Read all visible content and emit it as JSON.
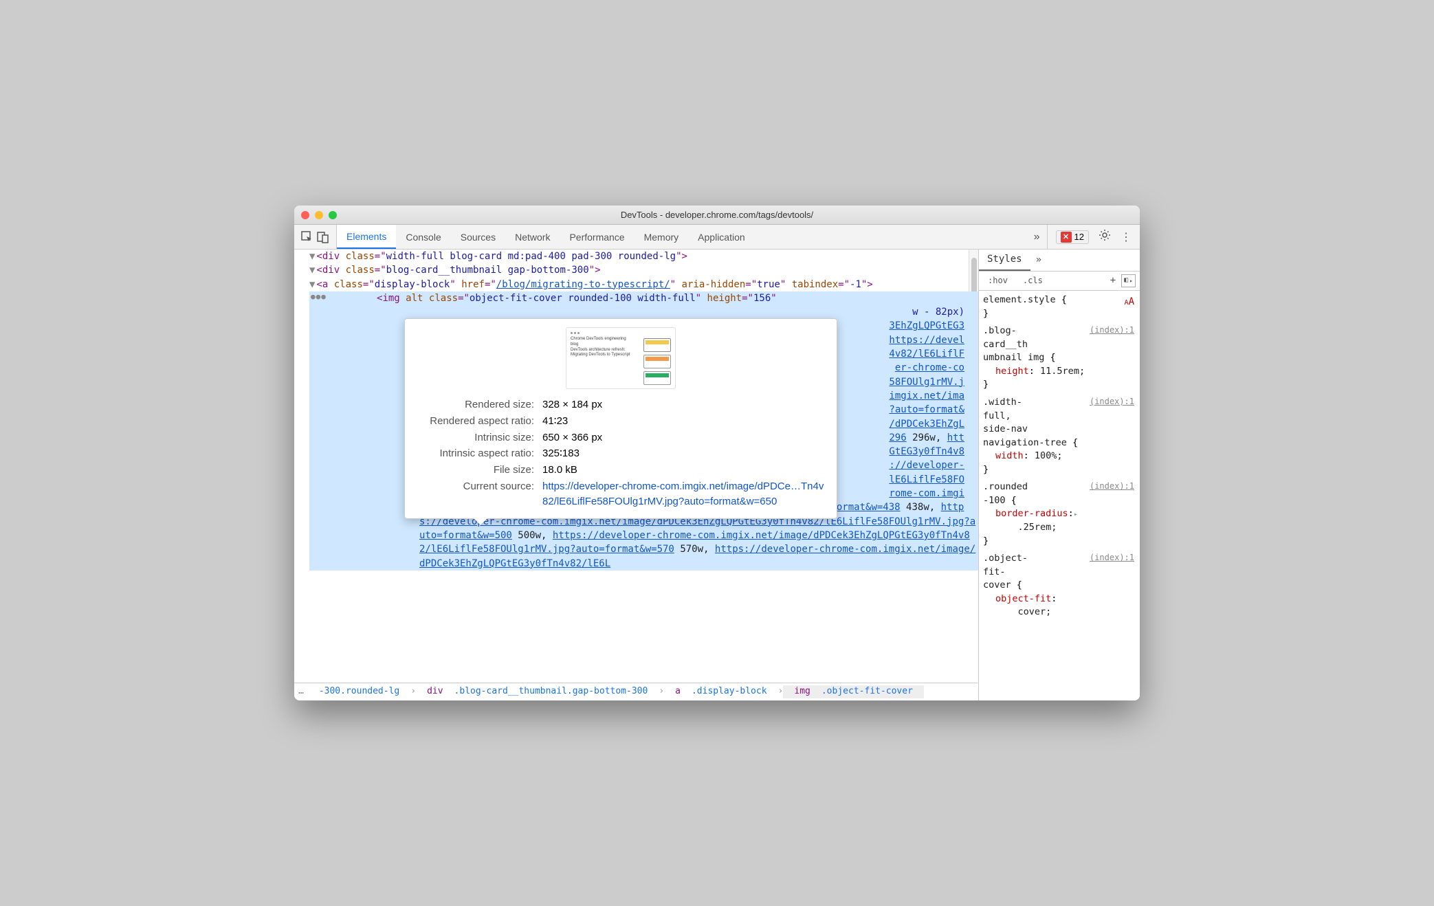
{
  "window": {
    "title": "DevTools - developer.chrome.com/tags/devtools/"
  },
  "tabs": [
    "Elements",
    "Console",
    "Sources",
    "Network",
    "Performance",
    "Memory",
    "Application"
  ],
  "activeTabIndex": 0,
  "errorCount": "12",
  "dom": {
    "l1_class": "width-full blog-card md:pad-400 pad-300 rounded-lg",
    "l2_class": "blog-card__thumbnail gap-bottom-300",
    "l3_class": "display-block",
    "l3_href": "/blog/migrating-to-typescript/",
    "l3_aria": "true",
    "l3_tabindex": "-1",
    "l4_tag": "img",
    "l4_class": "object-fit-cover rounded-100 width-full",
    "l4_height": "156",
    "snip_w82": "w - 82px)",
    "snip_hash": "3EhZgLQPGtEG3",
    "snip_https": "https://devel",
    "snip_4v82": "4v82/lE6LiflF",
    "snip_chrome": "er-chrome-co",
    "snip_58f": "58FOUlg1rMV.j",
    "snip_imgix": "imgix.net/ima",
    "snip_auto": "?auto=format&",
    "snip_dpd": "/dPDCek3EhZgL",
    "snip_296": "296",
    "snip_296w": "296w,",
    "snip_htt": "htt",
    "snip_gte": "GtEG3y0fTn4v8",
    "snip_dev2": "://developer-",
    "snip_le6": "lE6LiflFe58FO",
    "snip_rom": "rome-com.imgi",
    "srcset_l1": "x.net/image/dPDCek3EhZgLQPGtEG3y0fTn4v82/lE6LiflFe58FOUlg1rMV.jpg?auto=format&w=438",
    "srcset_l1w": "438w,",
    "srcset_l2": "https://developer-chrome-com.imgix.net/image/dPDCek3EhZgLQPGtEG3y0fTn4v82/lE6LiflFe58FOUlg1rMV.jpg?auto=format&w=500",
    "srcset_l2w": "500w,",
    "srcset_l3": "https://developer-chrome-com.imgix.net/image/dPDCek3EhZgLQPGtEG3y0fTn4v82/lE6LiflFe58FOUlg1rMV.jpg?auto=format&w=570",
    "srcset_l3w": "570w,",
    "srcset_l4": "https://developer-chrome-com.imgix.net/image/dPDCek3EhZgLQPGtEG3y0fTn4v82/lE6L"
  },
  "tooltip": {
    "thumb_line1": "Chrome DevTools engineering blog",
    "thumb_line2": "DevTools architecture refresh:",
    "thumb_line3": "Migrating DevTools to Typescript",
    "rows": [
      {
        "label": "Rendered size:",
        "value": "328 × 184 px"
      },
      {
        "label": "Rendered aspect ratio:",
        "value": "41∶23"
      },
      {
        "label": "Intrinsic size:",
        "value": "650 × 366 px"
      },
      {
        "label": "Intrinsic aspect ratio:",
        "value": "325∶183"
      },
      {
        "label": "File size:",
        "value": "18.0 kB"
      },
      {
        "label": "Current source:",
        "value": "https://developer-chrome-com.imgix.net/image/dPDCe…Tn4v82/lE6LiflFe58FOUlg1rMV.jpg?auto=format&w=650",
        "link": true
      }
    ]
  },
  "breadcrumb": [
    "…",
    "-300.rounded-lg",
    "div.blog-card__thumbnail.gap-bottom-300",
    "a.display-block",
    "img.object-fit-cover"
  ],
  "styles": {
    "tab": "Styles",
    "filterHov": ":hov",
    "filterCls": ".cls",
    "rules": [
      {
        "sel": "element.style {",
        "src": "",
        "props": []
      },
      {
        "sel": ".blog-card__thumbnail img {",
        "src": "(index):1",
        "props": [
          {
            "p": "height",
            "v": "11.5rem;"
          }
        ]
      },
      {
        "sel": ".width-full, side-nav navigation-tree {",
        "src": "(index):1",
        "props": [
          {
            "p": "width",
            "v": "100%;"
          }
        ]
      },
      {
        "sel": ".rounded-100 {",
        "src": "(index):1",
        "props": [
          {
            "p": "border-radius",
            "v": ".25rem;",
            "tri": true
          }
        ]
      },
      {
        "sel": ".object-fit-cover {",
        "src": "(index):1",
        "props": [
          {
            "p": "object-fit",
            "v": "cover;"
          }
        ]
      }
    ]
  }
}
